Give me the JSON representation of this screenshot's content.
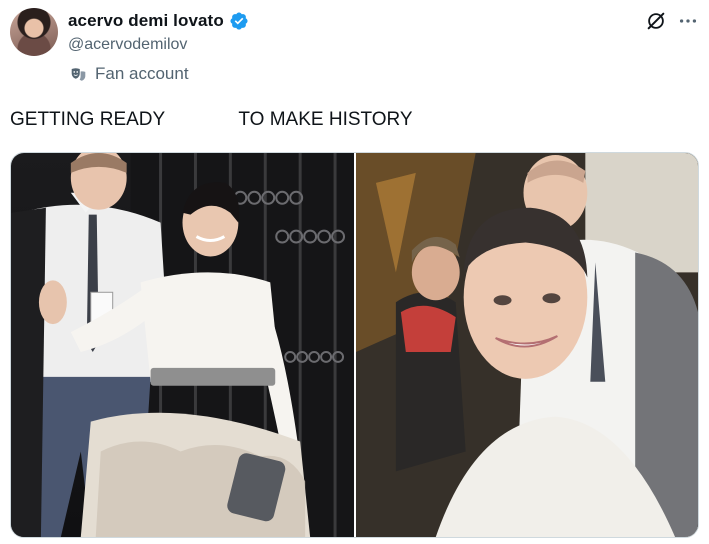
{
  "author": {
    "display_name": "acervo demi lovato",
    "handle": "@acervodemilov",
    "account_label": "Fan account",
    "verified_icon": "verified-badge-icon",
    "verified_color": "#1d9bf0"
  },
  "toolbar": {
    "grok_icon": "grok-icon",
    "more_icon": "more-options-icon"
  },
  "tweet": {
    "text": "GETTING READY              TO MAKE HISTORY"
  },
  "media": {
    "photos": [
      {
        "name": "photo-getting-ready",
        "icon": "photo"
      },
      {
        "name": "photo-make-history",
        "icon": "photo"
      }
    ]
  }
}
